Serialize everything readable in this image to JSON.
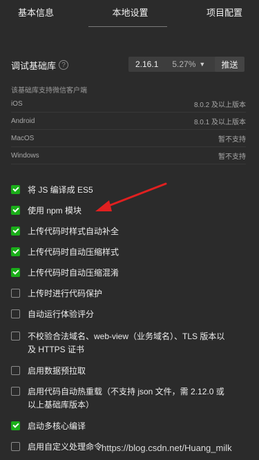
{
  "tabs": [
    "基本信息",
    "本地设置",
    "项目配置"
  ],
  "base_library": {
    "label": "调试基础库",
    "help_icon": "question-circle-icon",
    "version": "2.16.1",
    "percent": "5.27%",
    "caret_icon": "caret-down-icon",
    "push_label": "推送"
  },
  "support": {
    "title": "该基础库支持微信客户端",
    "rows": [
      {
        "platform": "iOS",
        "status": "8.0.2 及以上版本"
      },
      {
        "platform": "Android",
        "status": "8.0.1 及以上版本"
      },
      {
        "platform": "MacOS",
        "status": "暂不支持"
      },
      {
        "platform": "Windows",
        "status": "暂不支持"
      }
    ]
  },
  "options": [
    {
      "label": "将 JS 编译成 ES5",
      "checked": true
    },
    {
      "label": "使用 npm 模块",
      "checked": true
    },
    {
      "label": "上传代码时样式自动补全",
      "checked": true
    },
    {
      "label": "上传代码时自动压缩样式",
      "checked": true
    },
    {
      "label": "上传代码时自动压缩混淆",
      "checked": true
    },
    {
      "label": "上传时进行代码保护",
      "checked": false
    },
    {
      "label": "自动运行体验评分",
      "checked": false
    },
    {
      "label": "不校验合法域名、web-view（业务域名）、TLS 版本以及 HTTPS 证书",
      "checked": false
    },
    {
      "label": "启用数据预拉取",
      "checked": false
    },
    {
      "label": "启用代码自动热重载（不支持 json 文件，需 2.12.0 或以上基础库版本）",
      "checked": false
    },
    {
      "label": "启动多核心编译",
      "checked": true
    },
    {
      "label": "启用自定义处理命令",
      "checked": false
    }
  ],
  "colors": {
    "checkbox_on": "#1aad19",
    "arrow": "#e02020",
    "background": "#2b2b2b"
  },
  "watermark": "https://blog.csdn.net/Huang_milk"
}
